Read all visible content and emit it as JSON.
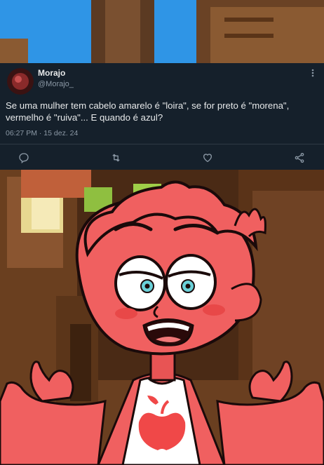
{
  "tweet": {
    "author_name": "Morajo",
    "author_handle": "@Morajo_",
    "text": "Se uma mulher tem cabelo amarelo é \"loira\", se for preto é \"morena\", vermelho é \"ruiva\"... E quando é azul?",
    "time": "06:27 PM",
    "date": "15 dez. 24",
    "meta_separator": " · "
  },
  "icons": {
    "reply": "reply-icon",
    "retweet": "retweet-icon",
    "like": "heart-icon",
    "share": "share-icon",
    "more": "more-options-icon"
  },
  "colors": {
    "background": "#15202b",
    "text": "#e7e9ea",
    "secondary": "#8b98a5",
    "character_skin": "#f06060"
  }
}
